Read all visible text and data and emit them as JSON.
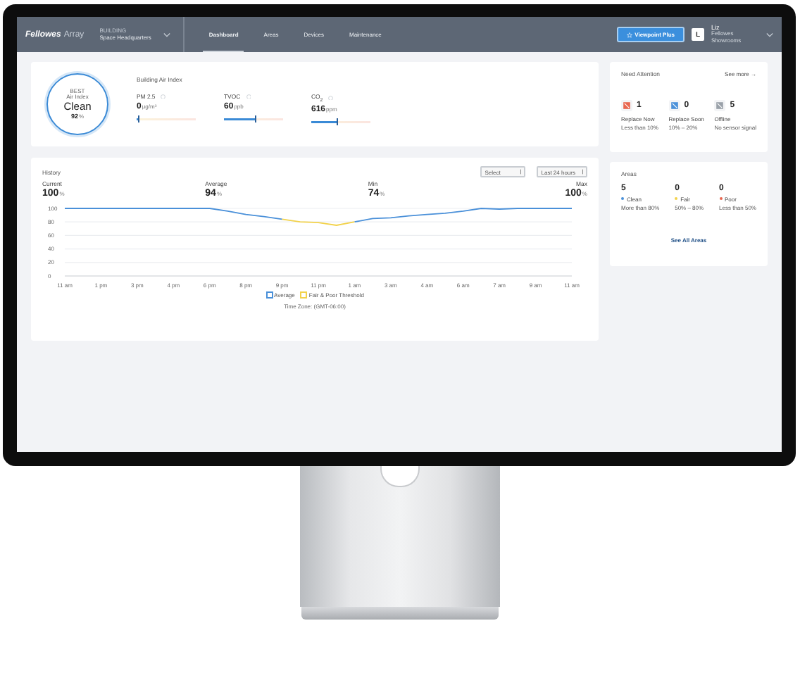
{
  "header": {
    "logo": "Fellowes",
    "logo_product": "Array",
    "building_label": "BUILDING",
    "building_name": "Space Headquarters",
    "tabs": [
      {
        "label": "Dashboard",
        "selected": true
      },
      {
        "label": "Areas",
        "selected": false
      },
      {
        "label": "Devices",
        "selected": false
      },
      {
        "label": "Maintenance",
        "selected": false
      }
    ],
    "upgrade_button": "Viewpoint Plus",
    "user": {
      "initial": "L",
      "name": "Liz",
      "org": "Fellowes Showrooms"
    }
  },
  "air_index": {
    "badge_label": "BEST",
    "badge_sublabel": "Air Index",
    "status": "Clean",
    "percent": "92",
    "percent_unit": "%",
    "title": "Building Air Index",
    "metrics": [
      {
        "name": "PM 2.5",
        "value": "0",
        "unit": "μg/m³",
        "level": 0.04
      },
      {
        "name": "TVOC",
        "value": "60",
        "unit": "ppb",
        "level": 0.55
      },
      {
        "name": "CO$_{2}$",
        "value": "616",
        "unit": "ppm",
        "level": 0.45
      }
    ]
  },
  "need_attention": {
    "title": "Need Attention",
    "link": "See more →",
    "items": [
      {
        "count": "1",
        "label": "Replace Now",
        "sub": "Less than 10%",
        "color": "#e8664f"
      },
      {
        "count": "0",
        "label": "Replace Soon",
        "sub": "10% – 20%",
        "color": "#4a90d9"
      },
      {
        "count": "5",
        "label": "Offline",
        "sub": "No sensor signal",
        "color": "#9aa1a9"
      }
    ]
  },
  "history": {
    "title": "History",
    "selects": [
      "Select",
      "Last 24 hours"
    ],
    "stats": [
      {
        "label": "Current",
        "value": "100",
        "unit": "%"
      },
      {
        "label": "Average",
        "value": "94",
        "unit": "%"
      },
      {
        "label": "Min",
        "value": "74",
        "unit": "%"
      },
      {
        "label": "Max",
        "value": "100",
        "unit": "%"
      }
    ],
    "chart_data": {
      "type": "line",
      "categories": [
        "11 am",
        null,
        "1 pm",
        null,
        "3 pm",
        null,
        "4 pm",
        null,
        "6 pm",
        null,
        "8 pm",
        null,
        "9 pm",
        null,
        "11 pm",
        null,
        "1 am",
        null,
        "3 am",
        null,
        "4 am",
        null,
        "6 am",
        null,
        "7 am",
        null,
        "9 am",
        null,
        "11 am"
      ],
      "ylim": [
        0,
        100
      ],
      "yticks": [
        0,
        20,
        40,
        60,
        80,
        100
      ],
      "grid": true,
      "series": [
        {
          "name": "Average",
          "color": "#4a90d9",
          "values": [
            100,
            100,
            100,
            100,
            100,
            100,
            100,
            100,
            100,
            96,
            91,
            88,
            84,
            null,
            null,
            null,
            80,
            85,
            86,
            89,
            91,
            93,
            96,
            100,
            99,
            100,
            100,
            100,
            100
          ]
        },
        {
          "name": "Fair & Poor Threshold",
          "color": "#f2d24b",
          "values": [
            null,
            null,
            null,
            null,
            null,
            null,
            null,
            null,
            null,
            null,
            null,
            null,
            84,
            80,
            79,
            75,
            80,
            null,
            null,
            null,
            null,
            null,
            null,
            null,
            null,
            null,
            null,
            null,
            null
          ]
        }
      ]
    },
    "timezone": "Time Zone: (GMT-06:00)"
  },
  "areas": {
    "title": "Areas",
    "link": "See All Areas",
    "items": [
      {
        "count": "5",
        "label": "Clean",
        "sub": "More than 80%",
        "color": "#4a90d9"
      },
      {
        "count": "0",
        "label": "Fair",
        "sub": "50% – 80%",
        "color": "#f2d24b"
      },
      {
        "count": "0",
        "label": "Poor",
        "sub": "Less than 50%",
        "color": "#e8664f"
      }
    ]
  }
}
